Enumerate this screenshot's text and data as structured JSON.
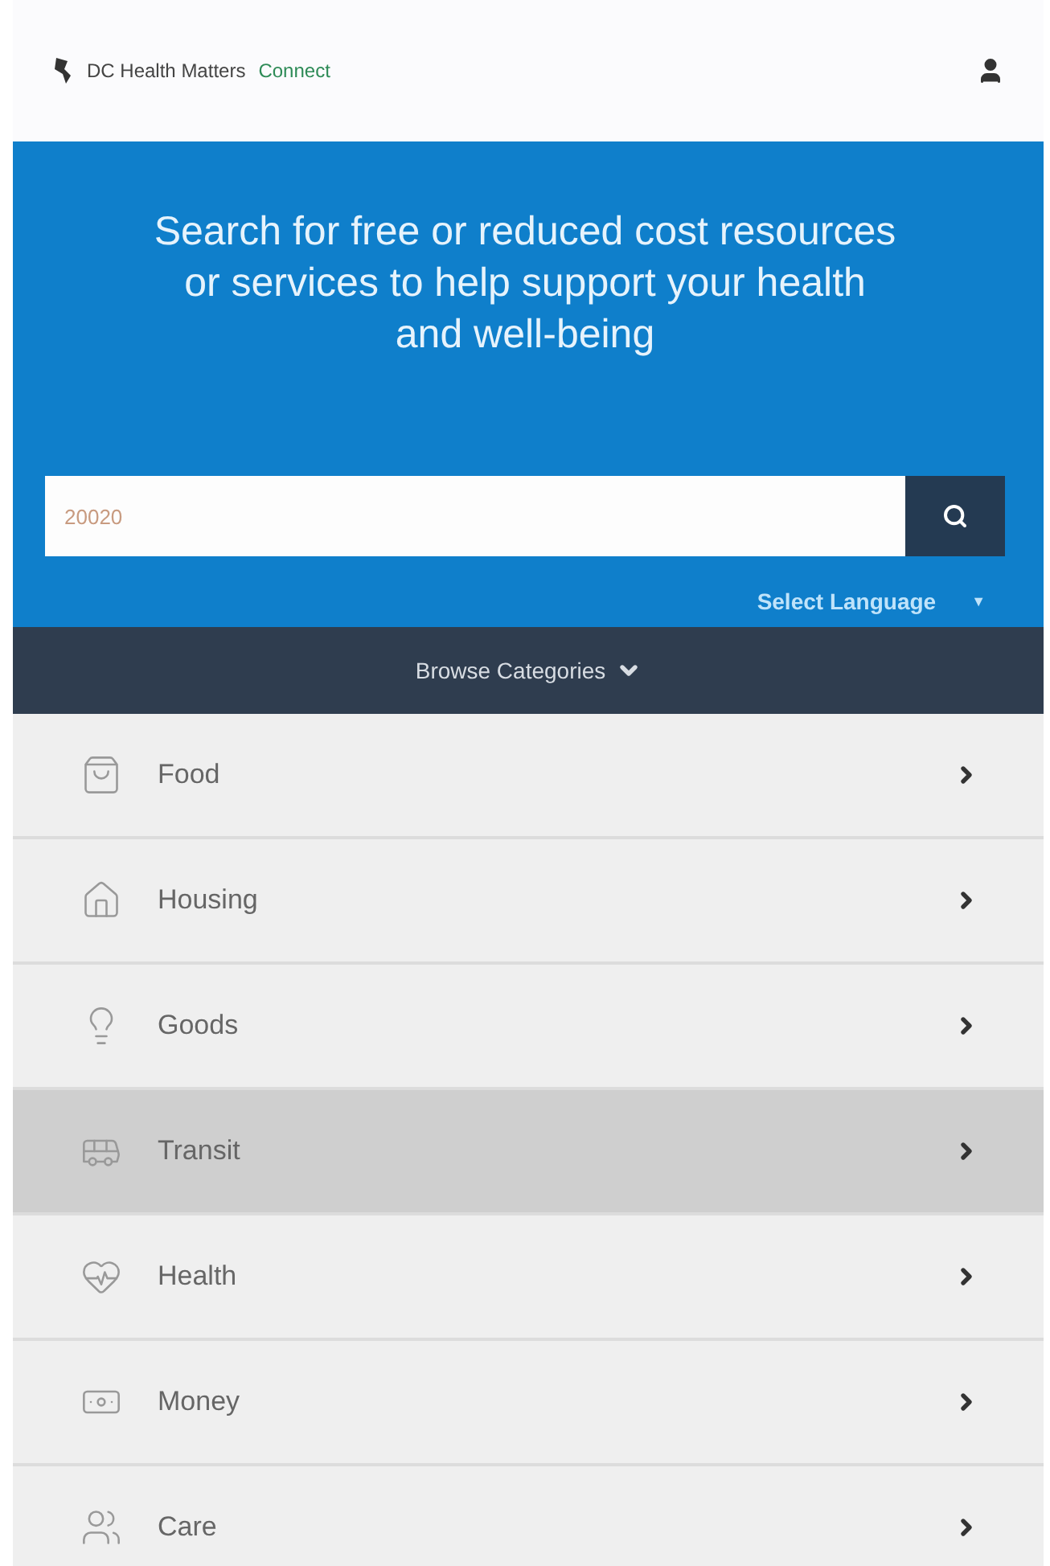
{
  "header": {
    "brand": "DC Health Matters",
    "product": "Connect"
  },
  "hero": {
    "heading": "Search for free or reduced cost resources or services to help support your health and well-being"
  },
  "search": {
    "value": "20020"
  },
  "language": {
    "label": "Select Language",
    "caret": "▼"
  },
  "browse": {
    "label": "Browse Categories"
  },
  "categories": [
    {
      "label": "Food",
      "selected": false
    },
    {
      "label": "Housing",
      "selected": false
    },
    {
      "label": "Goods",
      "selected": false
    },
    {
      "label": "Transit",
      "selected": true
    },
    {
      "label": "Health",
      "selected": false
    },
    {
      "label": "Money",
      "selected": false
    },
    {
      "label": "Care",
      "selected": false
    }
  ]
}
